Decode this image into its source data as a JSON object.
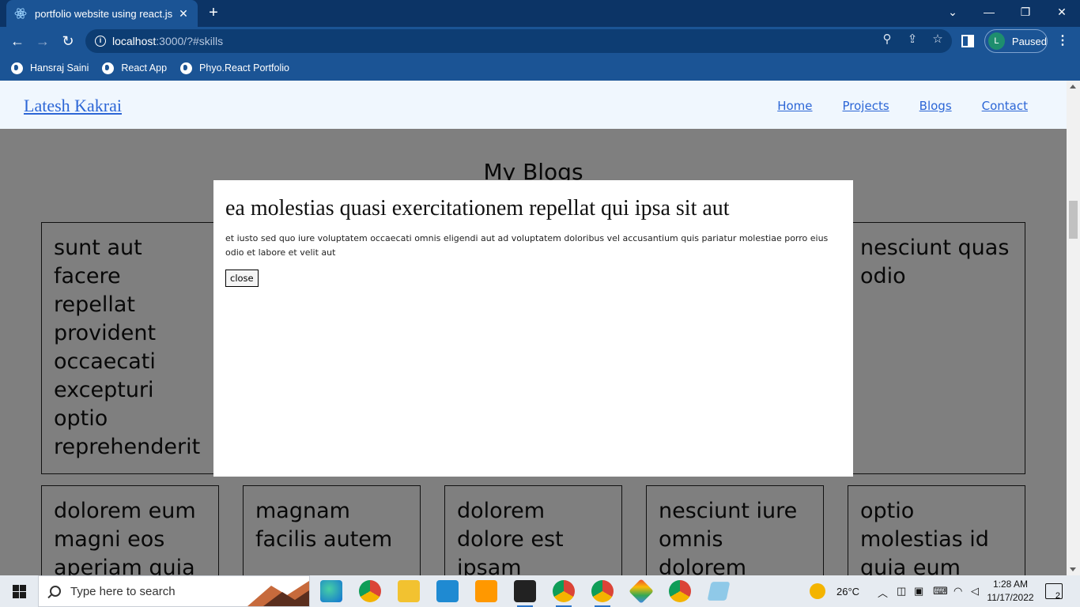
{
  "browser": {
    "tab_title": "portfolio website using react.js",
    "tab_close": "✕",
    "new_tab": "+",
    "url_host": "localhost",
    "url_path": ":3000/?#skills",
    "profile_initial": "L",
    "profile_status": "Paused",
    "bookmarks": [
      "Hansraj Saini",
      "React App",
      "Phyo.React Portfolio"
    ]
  },
  "site": {
    "brand": "Latesh Kakrai",
    "nav": [
      "Home",
      "Projects",
      "Blogs",
      "Contact"
    ],
    "section_title": "My Blogs"
  },
  "cards": [
    "sunt aut facere repellat provident occaecati excepturi optio reprehenderit",
    "nesciunt quas odio",
    "dolorem eum magni eos aperiam quia",
    "magnam facilis autem",
    "dolorem dolore est ipsam",
    "nesciunt iure omnis dolorem",
    "optio molestias id quia eum"
  ],
  "modal": {
    "title": "ea molestias quasi exercitationem repellat qui ipsa sit aut",
    "body": "et iusto sed quo iure voluptatem occaecati omnis eligendi aut ad voluptatem doloribus vel accusantium quis pariatur molestiae porro eius odio et labore et velit aut",
    "close_label": "close"
  },
  "taskbar": {
    "search_placeholder": "Type here to search",
    "temperature": "26°C",
    "time": "1:28 AM",
    "date": "11/17/2022",
    "notifications": "2",
    "apps": [
      "edge-icon",
      "chrome-icon",
      "file-explorer-icon",
      "vscode-icon",
      "sublime-text-icon",
      "terminal-icon",
      "chrome-profile-icon",
      "chrome-profile-2-icon",
      "git-icon",
      "chrome-people-icon",
      "notepad-icon"
    ]
  },
  "colors": {
    "titlebar": "#0c3466",
    "toolbar": "#1b5495",
    "link": "#2c66d6",
    "navbar_bg": "#f0f7fe",
    "overlay": "rgba(0,0,0,0.5)"
  }
}
